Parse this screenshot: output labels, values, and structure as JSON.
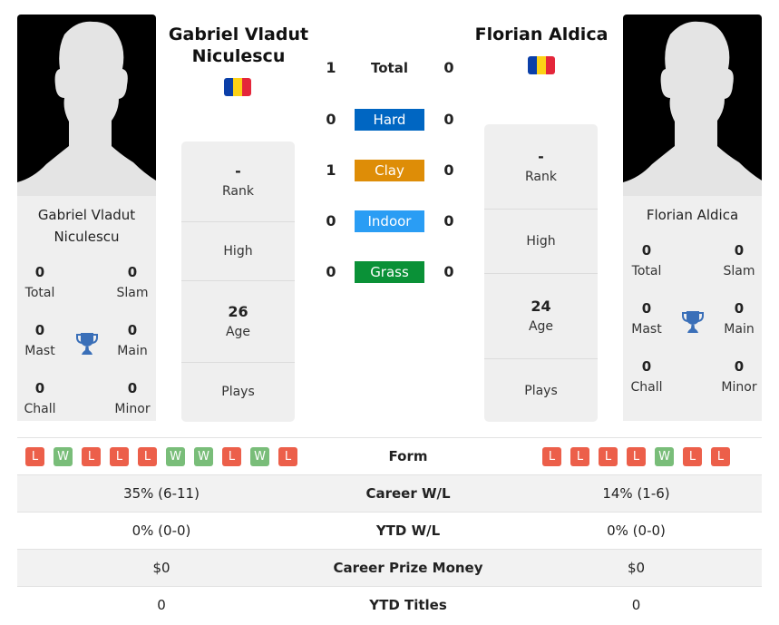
{
  "player1": {
    "name_header": "Gabriel Vladut Niculescu",
    "name_card": "Gabriel Vladut Niculescu",
    "flag": {
      "country": "Romania",
      "colors": [
        "#0b3fa8",
        "#fcd116",
        "#e4263a"
      ]
    },
    "titles": {
      "total": {
        "value": "0",
        "label": "Total"
      },
      "slam": {
        "value": "0",
        "label": "Slam"
      },
      "mast": {
        "value": "0",
        "label": "Mast"
      },
      "main": {
        "value": "0",
        "label": "Main"
      },
      "chall": {
        "value": "0",
        "label": "Chall"
      },
      "minor": {
        "value": "0",
        "label": "Minor"
      }
    },
    "info": {
      "rank": {
        "value": "-",
        "label": "Rank"
      },
      "high": {
        "value": "",
        "label": "High"
      },
      "age": {
        "value": "26",
        "label": "Age"
      },
      "plays": {
        "value": "",
        "label": "Plays"
      }
    },
    "form": [
      "L",
      "W",
      "L",
      "L",
      "L",
      "W",
      "W",
      "L",
      "W",
      "L"
    ]
  },
  "player2": {
    "name_header": "Florian Aldica",
    "name_card": "Florian Aldica",
    "flag": {
      "country": "Romania",
      "colors": [
        "#0b3fa8",
        "#fcd116",
        "#e4263a"
      ]
    },
    "titles": {
      "total": {
        "value": "0",
        "label": "Total"
      },
      "slam": {
        "value": "0",
        "label": "Slam"
      },
      "mast": {
        "value": "0",
        "label": "Mast"
      },
      "main": {
        "value": "0",
        "label": "Main"
      },
      "chall": {
        "value": "0",
        "label": "Chall"
      },
      "minor": {
        "value": "0",
        "label": "Minor"
      }
    },
    "info": {
      "rank": {
        "value": "-",
        "label": "Rank"
      },
      "high": {
        "value": "",
        "label": "High"
      },
      "age": {
        "value": "24",
        "label": "Age"
      },
      "plays": {
        "value": "",
        "label": "Plays"
      }
    },
    "form": [
      "L",
      "L",
      "L",
      "L",
      "W",
      "L",
      "L"
    ]
  },
  "h2h": [
    {
      "label": "Total",
      "p1": "1",
      "p2": "0",
      "color": ""
    },
    {
      "label": "Hard",
      "p1": "0",
      "p2": "0",
      "color": "#0066c2"
    },
    {
      "label": "Clay",
      "p1": "1",
      "p2": "0",
      "color": "#de8d07"
    },
    {
      "label": "Indoor",
      "p1": "0",
      "p2": "0",
      "color": "#2a9df4"
    },
    {
      "label": "Grass",
      "p1": "0",
      "p2": "0",
      "color": "#0a9137"
    }
  ],
  "stats": [
    {
      "label": "Form",
      "p1": "",
      "p2": ""
    },
    {
      "label": "Career W/L",
      "p1": "35% (6-11)",
      "p2": "14% (1-6)"
    },
    {
      "label": "YTD W/L",
      "p1": "0% (0-0)",
      "p2": "0% (0-0)"
    },
    {
      "label": "Career Prize Money",
      "p1": "$0",
      "p2": "$0"
    },
    {
      "label": "YTD Titles",
      "p1": "0",
      "p2": "0"
    }
  ],
  "icons": {
    "trophy": "trophy-icon",
    "avatar": "person-silhouette-icon"
  },
  "colors": {
    "trophy": "#3a6fb8",
    "loss": "#ec5f4a",
    "win": "#79bd79"
  }
}
